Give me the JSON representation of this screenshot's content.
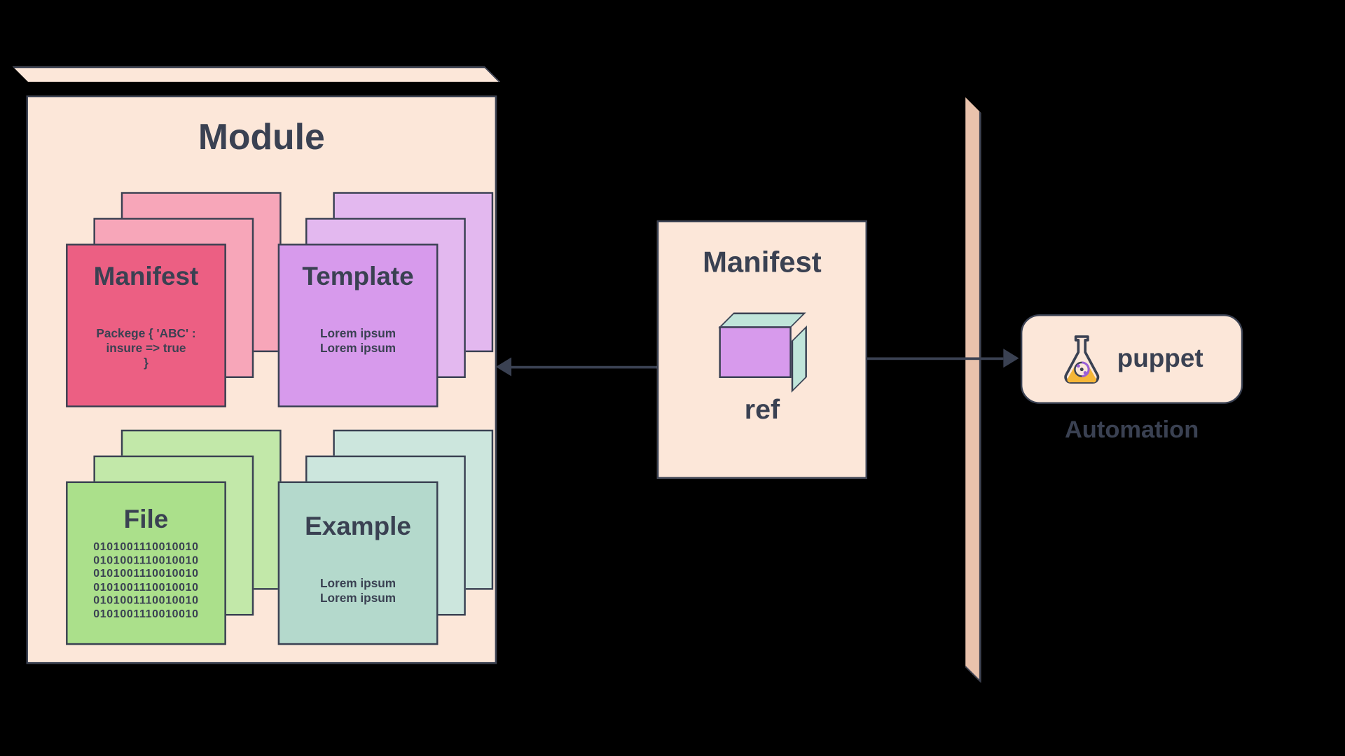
{
  "module": {
    "title": "Module",
    "cards": {
      "manifest": {
        "title": "Manifest",
        "body": "Packege { 'ABC' :\ninsure => true\n}"
      },
      "template": {
        "title": "Template",
        "body": "Lorem ipsum\nLorem ipsum"
      },
      "file": {
        "title": "File",
        "body": "0101001110010010\n0101001110010010\n0101001110010010\n0101001110010010\n0101001110010010\n0101001110010010"
      },
      "example": {
        "title": "Example",
        "body": "Lorem ipsum\nLorem ipsum"
      }
    }
  },
  "ref_panel": {
    "title": "Manifest",
    "label": "ref"
  },
  "puppet": {
    "name": "puppet",
    "caption": "Automation"
  },
  "colors": {
    "panel_bg": "#fce7d9",
    "stroke": "#3a4152",
    "manifest": "#ec5f83",
    "template": "#d79aec",
    "file": "#abe08b",
    "example": "#b4d9cc"
  }
}
